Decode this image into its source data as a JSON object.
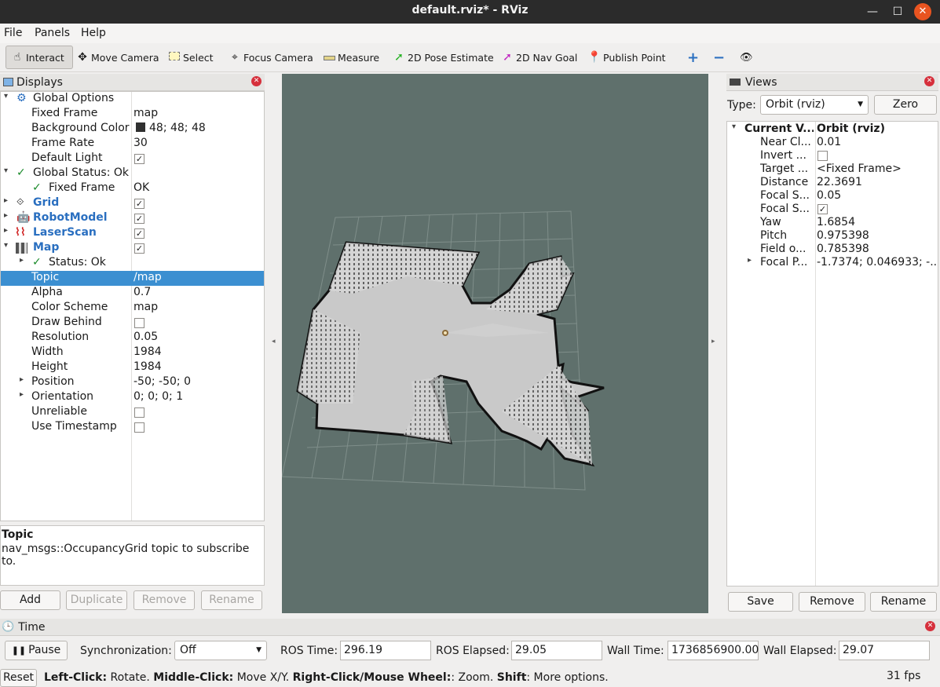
{
  "window": {
    "title": "default.rviz* - RViz"
  },
  "menu": {
    "file": "File",
    "panels": "Panels",
    "help": "Help"
  },
  "toolbar": {
    "interact": "Interact",
    "move_camera": "Move Camera",
    "select": "Select",
    "focus_camera": "Focus Camera",
    "measure": "Measure",
    "pose_estimate": "2D Pose Estimate",
    "nav_goal": "2D Nav Goal",
    "publish_point": "Publish Point"
  },
  "displays": {
    "title": "Displays",
    "rows": {
      "global_options": "Global Options",
      "fixed_frame_label": "Fixed Frame",
      "fixed_frame_value": "map",
      "background_label": "Background Color",
      "background_value": "48; 48; 48",
      "frame_rate_label": "Frame Rate",
      "frame_rate_value": "30",
      "default_light_label": "Default Light",
      "global_status": "Global Status: Ok",
      "gs_fixed_frame_label": "Fixed Frame",
      "gs_fixed_frame_value": "OK",
      "grid": "Grid",
      "robot_model": "RobotModel",
      "laser_scan": "LaserScan",
      "map": "Map",
      "status_ok": "Status: Ok",
      "topic_label": "Topic",
      "topic_value": "/map",
      "alpha_label": "Alpha",
      "alpha_value": "0.7",
      "color_scheme_label": "Color Scheme",
      "color_scheme_value": "map",
      "draw_behind_label": "Draw Behind",
      "resolution_label": "Resolution",
      "resolution_value": "0.05",
      "width_label": "Width",
      "width_value": "1984",
      "height_label": "Height",
      "height_value": "1984",
      "position_label": "Position",
      "position_value": "-50; -50; 0",
      "orientation_label": "Orientation",
      "orientation_value": "0; 0; 0; 1",
      "unreliable_label": "Unreliable",
      "use_timestamp_label": "Use Timestamp"
    },
    "description_title": "Topic",
    "description_text": "nav_msgs::OccupancyGrid topic to subscribe to.",
    "buttons": {
      "add": "Add",
      "duplicate": "Duplicate",
      "remove": "Remove",
      "rename": "Rename"
    }
  },
  "views": {
    "title": "Views",
    "type_label": "Type:",
    "type_value": "Orbit (rviz)",
    "zero": "Zero",
    "current_label": "Current V...",
    "current_value": "Orbit (rviz)",
    "near_clip_label": "Near Cl...",
    "near_clip_value": "0.01",
    "invert_label": "Invert ...",
    "target_label": "Target ...",
    "target_value": "<Fixed Frame>",
    "distance_label": "Distance",
    "distance_value": "22.3691",
    "focal_size_label": "Focal S...",
    "focal_size_value": "0.05",
    "focal_shape_label": "Focal S...",
    "yaw_label": "Yaw",
    "yaw_value": "1.6854",
    "pitch_label": "Pitch",
    "pitch_value": "0.975398",
    "field_label": "Field o...",
    "field_value": "0.785398",
    "focal_point_label": "Focal P...",
    "focal_point_value": "-1.7374; 0.046933; -...",
    "buttons": {
      "save": "Save",
      "remove": "Remove",
      "rename": "Rename"
    }
  },
  "time": {
    "title": "Time",
    "pause": "Pause",
    "sync_label": "Synchronization:",
    "sync_value": "Off",
    "ros_time_label": "ROS Time:",
    "ros_time_value": "296.19",
    "ros_elapsed_label": "ROS Elapsed:",
    "ros_elapsed_value": "29.05",
    "wall_time_label": "Wall Time:",
    "wall_time_value": "1736856900.00",
    "wall_elapsed_label": "Wall Elapsed:",
    "wall_elapsed_value": "29.07"
  },
  "status": {
    "reset": "Reset",
    "left_click_key": "Left-Click:",
    "left_click_val": " Rotate. ",
    "middle_click_key": "Middle-Click:",
    "middle_click_val": " Move X/Y. ",
    "right_click_key": "Right-Click/Mouse Wheel:",
    "right_click_val": ": Zoom. ",
    "shift_key": "Shift",
    "shift_val": ": More options.",
    "fps": "31 fps"
  },
  "colors": {
    "selection": "#3b8fd1",
    "viewport_bg": "#5f706c",
    "link_blue": "#2a6fc0",
    "ok_green": "#1a8a2a"
  }
}
